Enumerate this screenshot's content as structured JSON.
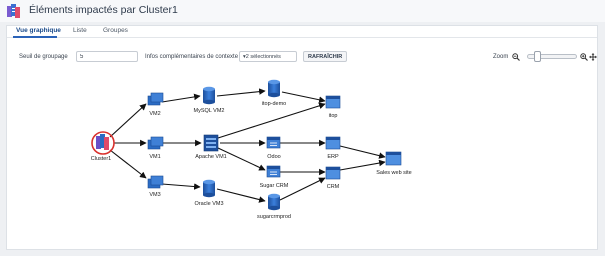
{
  "header": {
    "title": "Éléments impactés par Cluster1"
  },
  "tabs": [
    {
      "label": "Vue graphique",
      "active": true
    },
    {
      "label": "Liste",
      "active": false
    },
    {
      "label": "Groupes",
      "active": false
    }
  ],
  "toolbar": {
    "grouping_label": "Seuil de groupage",
    "grouping_value": "5",
    "context_label": "Infos complémentaires de contexte",
    "context_select": "▾2 sélectionnés",
    "refresh_label": "RAFRAÎCHIR",
    "zoom_label": "Zoom"
  },
  "nodes": {
    "cluster1": "Cluster1",
    "vm2": "VM2",
    "vm1": "VM1",
    "vm3": "VM3",
    "mysql_vm2": "MySQL VM2",
    "apache_vm1": "Apache VM1",
    "oracle_vm3": "Oracle VM3",
    "itop_demo": "itop-demo",
    "itop": "itop",
    "odoo": "Odoo",
    "erp": "ERP",
    "sugar_crm": "Sugar CRM",
    "crm": "CRM",
    "sugarcrmprod": "sugarcrmprod",
    "sales_web_site": "Sales web site"
  },
  "colors": {
    "accent": "#2a62b8",
    "server_blue": "#2b6cc4",
    "highlight_ring": "#d9302c"
  }
}
